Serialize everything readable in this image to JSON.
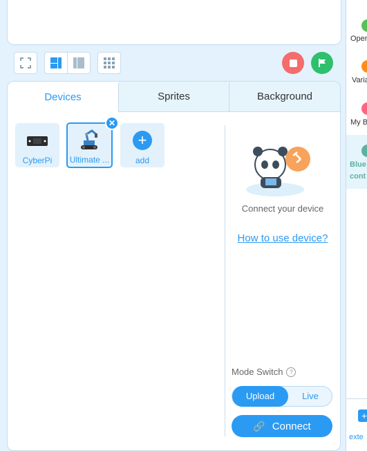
{
  "tabs": [
    {
      "label": "Devices",
      "active": true
    },
    {
      "label": "Sprites",
      "active": false
    },
    {
      "label": "Background",
      "active": false
    }
  ],
  "devices": [
    {
      "label": "CyberPi",
      "icon": "cyberpi-device-icon"
    },
    {
      "label": "Ultimate ...",
      "icon": "ultimate-robot-icon",
      "selected": true
    }
  ],
  "add_label": "add",
  "connect_panel": {
    "hint": "Connect your device",
    "help_link": "How to use device?",
    "mode_switch_label": "Mode Switch",
    "mode_options": [
      "Upload",
      "Live"
    ],
    "active_mode": "Upload",
    "connect_label": "Connect"
  },
  "sidebar": {
    "categories": [
      {
        "label": "Oper",
        "color": "#59c059"
      },
      {
        "label": "Varia",
        "color": "#ff8c1a"
      },
      {
        "label": "My B",
        "color": "#ff6680"
      },
      {
        "label": "Blue",
        "label2": "cont",
        "color": "#5cb1a0",
        "active": true
      }
    ],
    "extension_label": "exte"
  },
  "colors": {
    "accent": "#2b9af3",
    "stop": "#f46c6c",
    "go": "#2dc06d",
    "panel_bg": "#e3f2fc"
  }
}
